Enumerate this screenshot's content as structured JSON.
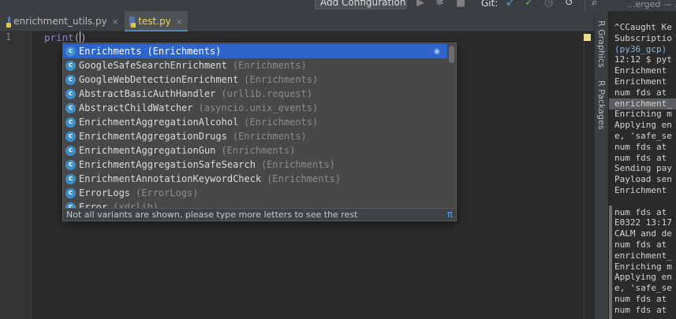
{
  "toolbar": {
    "run_config_label": "Add Configuration...",
    "git_label": "Git:"
  },
  "tabs": [
    {
      "label": "enrichment_utils.py",
      "close": "×",
      "active": false
    },
    {
      "label": "test.py",
      "close": "×",
      "active": true
    }
  ],
  "editor": {
    "line_number": "1",
    "code_keyword": "print",
    "code_open_paren": "(",
    "code_close_paren": ")"
  },
  "completion": {
    "icon_letter": "c",
    "items": [
      {
        "name": "Enrichments",
        "module": "(Enrichments)",
        "selected": true
      },
      {
        "name": "GoogleSafeSearchEnrichment",
        "module": "(Enrichments)",
        "selected": false
      },
      {
        "name": "GoogleWebDetectionEnrichment",
        "module": "(Enrichments)",
        "selected": false
      },
      {
        "name": "AbstractBasicAuthHandler",
        "module": "(urllib.request)",
        "selected": false
      },
      {
        "name": "AbstractChildWatcher",
        "module": "(asyncio.unix_events)",
        "selected": false
      },
      {
        "name": "EnrichmentAggregationAlcohol",
        "module": "(Enrichments)",
        "selected": false
      },
      {
        "name": "EnrichmentAggregationDrugs",
        "module": "(Enrichments)",
        "selected": false
      },
      {
        "name": "EnrichmentAggregationGun",
        "module": "(Enrichments)",
        "selected": false
      },
      {
        "name": "EnrichmentAggregationSafeSearch",
        "module": "(Enrichments)",
        "selected": false
      },
      {
        "name": "EnrichmentAnnotationKeywordCheck",
        "module": "(Enrichments)",
        "selected": false
      },
      {
        "name": "ErrorLogs",
        "module": "(ErrorLogs)",
        "selected": false
      },
      {
        "name": "Error",
        "module": "(xdrlib)",
        "selected": false
      }
    ],
    "footer_text": "Not all variants are shown, please type more letters to see the rest",
    "footer_link": "π"
  },
  "tool_windows": [
    "R Graphics",
    "R Packages"
  ],
  "terminal": {
    "header": "...erged — ...",
    "lines": [
      {
        "text": "^CCaught Ke",
        "style": "normal"
      },
      {
        "text": "Subscriptio",
        "style": "normal"
      },
      {
        "text": "(py36_gcp) ",
        "style": "env"
      },
      {
        "text": "12:12 $ pyt",
        "style": "normal"
      },
      {
        "text": "Enrichment ",
        "style": "normal"
      },
      {
        "text": "Enrichment ",
        "style": "normal"
      },
      {
        "text": "num fds at ",
        "style": "normal"
      },
      {
        "text": "enrichment_",
        "style": "hl"
      },
      {
        "text": "Enriching m",
        "style": "normal"
      },
      {
        "text": "Applying en",
        "style": "normal"
      },
      {
        "text": "e, 'safe_se",
        "style": "normal"
      },
      {
        "text": "num fds at ",
        "style": "normal"
      },
      {
        "text": "num fds at ",
        "style": "normal"
      },
      {
        "text": "Sending pay",
        "style": "normal"
      },
      {
        "text": "Payload sen",
        "style": "normal"
      },
      {
        "text": "Enrichment ",
        "style": "normal"
      },
      {
        "text": "",
        "style": "normal"
      },
      {
        "text": "num fds at ",
        "style": "normal"
      },
      {
        "text": "E0322 13:17",
        "style": "normal"
      },
      {
        "text": "CALM and de",
        "style": "normal"
      },
      {
        "text": "num fds at ",
        "style": "normal"
      },
      {
        "text": "enrichment_",
        "style": "normal"
      },
      {
        "text": "Enriching m",
        "style": "normal"
      },
      {
        "text": "Applying en",
        "style": "normal"
      },
      {
        "text": "e, 'safe_se",
        "style": "normal"
      },
      {
        "text": "num fds at ",
        "style": "normal"
      },
      {
        "text": "num fds at ",
        "style": "normal"
      }
    ]
  },
  "colors": {
    "selection": "#2f65ca",
    "class_icon": "#3d8ec9",
    "active_tab_text": "#e3d46c",
    "tab_underline": "#4a88c7"
  }
}
